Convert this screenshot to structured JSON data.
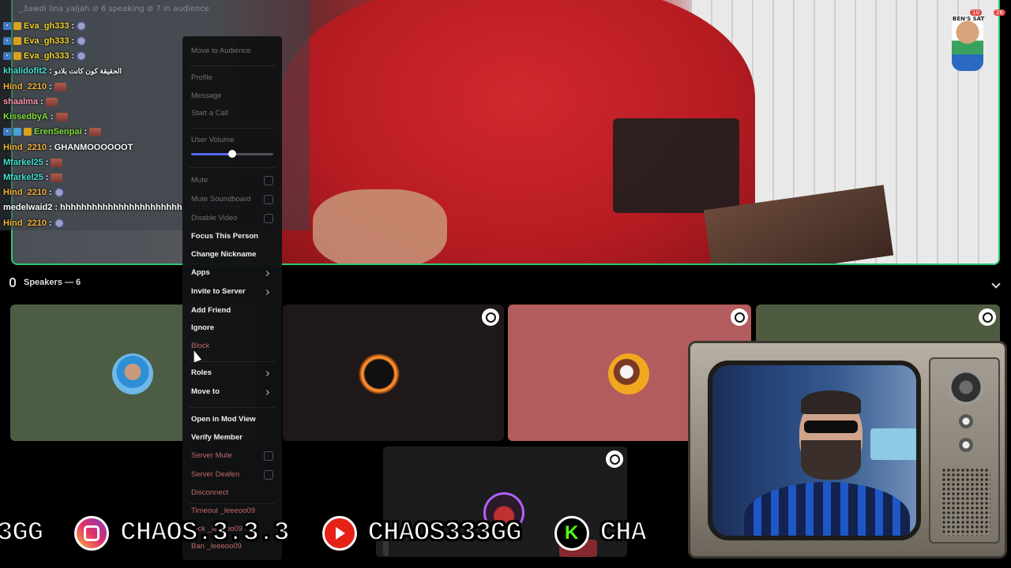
{
  "chat": {
    "header": "_3awdi lina yaljah   ⊘ 6 speaking   ⊘ 7 in audience",
    "lines": [
      {
        "user": "Eva_gh333",
        "sep": ":",
        "message": ""
      },
      {
        "user": "Eva_gh333",
        "sep": ":",
        "message": ""
      },
      {
        "user": "Eva_gh333",
        "sep": ":",
        "message": ""
      },
      {
        "user": "khalidofit2",
        "sep": ":",
        "message": "الحقيقة كون كانت بلادو"
      },
      {
        "user": "Hind_2210",
        "sep": ":",
        "message": ""
      },
      {
        "user": "shaalma",
        "sep": ":",
        "message": ""
      },
      {
        "user": "KissedbyA",
        "sep": ":",
        "message": ""
      },
      {
        "user": "ErenSenpai",
        "sep": ":",
        "message": ""
      },
      {
        "user": "Hind_2210",
        "sep": ":",
        "message": "GHANMOOOOOOT"
      },
      {
        "user": "Mfarkel25",
        "sep": ":",
        "message": ""
      },
      {
        "user": "Mfarkel25",
        "sep": ":",
        "message": ""
      },
      {
        "user": "Hind_2210",
        "sep": ":",
        "message": ""
      },
      {
        "user": "medelwaid2",
        "sep": ":",
        "message": "hhhhhhhhhhhhhhhhhhhhhhhhhhhhhhhhhh"
      },
      {
        "user": "Hind_2210",
        "sep": ":",
        "message": ""
      }
    ]
  },
  "sticker": {
    "label": "BEN'S SAT",
    "count_a": "10",
    "count_b": "26"
  },
  "speakers": {
    "title": "Speakers — 6"
  },
  "context_menu": {
    "move_to_audience": "Move to Audience",
    "profile": "Profile",
    "message": "Message",
    "start_call": "Start a Call",
    "user_volume": "User Volume",
    "user_volume_level": 0.5,
    "mute": "Mute",
    "mute_soundboard": "Mute Soundboard",
    "disable_video": "Disable Video",
    "focus_person": "Focus This Person",
    "change_nickname": "Change Nickname",
    "apps": "Apps",
    "invite_server": "Invite to Server",
    "add_friend": "Add Friend",
    "ignore": "Ignore",
    "block": "Block",
    "roles": "Roles",
    "move_to": "Move to",
    "open_mod_view": "Open in Mod View",
    "verify_member": "Verify Member",
    "server_mute": "Server Mute",
    "server_deafen": "Server Deafen",
    "disconnect": "Disconnect",
    "timeout": "Timeout _leeeoo09",
    "kick": "Kick _leeeoo09",
    "ban": "Ban _leeeoo09"
  },
  "ticker": {
    "item_1": "3GG",
    "item_2": "CHAOS.3.3.3",
    "item_3": "CHAOS333GG",
    "item_4": "CHA",
    "kick_letter": "K"
  },
  "colors": {
    "tile_green": "#4c5d44",
    "tile_dark": "#1e1819",
    "tile_rose": "#b35c5e",
    "tile_olive": "#4f5b40",
    "speaking_ring": "#2dc770",
    "accent": "#5865f2"
  }
}
